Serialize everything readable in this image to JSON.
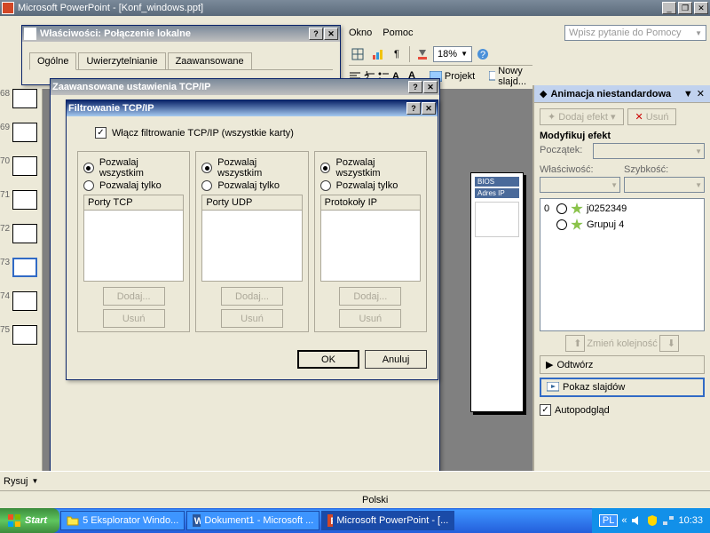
{
  "app": {
    "title": "Microsoft PowerPoint - [Konf_windows.ppt]"
  },
  "menu": {
    "window": "Okno",
    "help": "Pomoc"
  },
  "help_search": "Wpisz pytanie do Pomocy",
  "toolbar": {
    "zoom": "18%",
    "project": "Projekt",
    "new_slide": "Nowy slajd..."
  },
  "thumbs": [
    {
      "num": "68"
    },
    {
      "num": "69"
    },
    {
      "num": "70"
    },
    {
      "num": "71"
    },
    {
      "num": "72"
    },
    {
      "num": "73",
      "selected": true
    },
    {
      "num": "74"
    },
    {
      "num": "75"
    }
  ],
  "slide_peek": {
    "band1": "BIOS",
    "band2": "Adres IP"
  },
  "anim": {
    "title": "Animacja niestandardowa",
    "add_effect": "Dodaj efekt",
    "remove": "Usuń",
    "modify": "Modyfikuj efekt",
    "start": "Początek:",
    "property": "Właściwość:",
    "speed": "Szybkość:",
    "items": [
      {
        "idx": "0",
        "name": "j0252349"
      },
      {
        "idx": "",
        "name": "Grupuj 4"
      }
    ],
    "reorder": "Zmień kolejność",
    "play": "Odtwórz",
    "slideshow": "Pokaz slajdów",
    "autopreview": "Autopodgląd"
  },
  "props_dlg": {
    "title": "Właściwości: Połączenie lokalne",
    "tab1": "Ogólne",
    "tab2": "Uwierzytelnianie",
    "tab3": "Zaawansowane"
  },
  "adv_dlg": {
    "title": "Zaawansowane ustawienia TCP/IP",
    "ok": "OK",
    "cancel": "Anuluj"
  },
  "filter_dlg": {
    "title": "Filtrowanie TCP/IP",
    "enable": "Włącz filtrowanie TCP/IP (wszystkie karty)",
    "allow_all": "Pozwalaj wszystkim",
    "allow_only": "Pozwalaj tylko",
    "col1": "Porty TCP",
    "col2": "Porty UDP",
    "col3": "Protokoły IP",
    "add": "Dodaj...",
    "remove": "Usuń",
    "ok": "OK",
    "cancel": "Anuluj"
  },
  "draw_tb": {
    "draw": "Rysuj"
  },
  "status": {
    "lang": "Polski"
  },
  "taskbar": {
    "start": "Start",
    "task1": "5 Eksplorator Windo...",
    "task2": "Dokument1 - Microsoft ...",
    "task3": "Microsoft PowerPoint - [...",
    "lang": "PL",
    "time": "10:33"
  }
}
